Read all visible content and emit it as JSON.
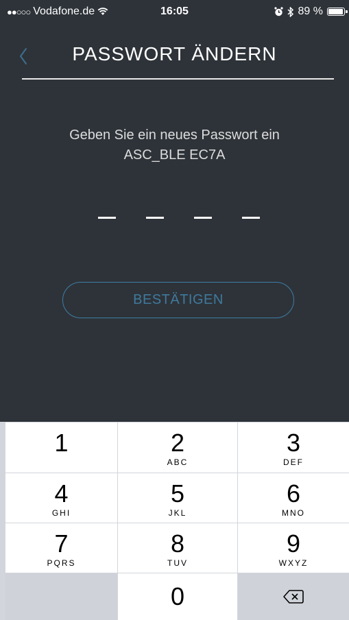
{
  "status": {
    "carrier": "Vodafone.de",
    "time": "16:05",
    "battery": "89 %",
    "battery_level": 0.89
  },
  "nav": {
    "title": "PASSWORT ÄNDERN"
  },
  "prompt": {
    "line1": "Geben Sie ein neues Passwort ein",
    "line2": "ASC_BLE EC7A"
  },
  "confirm_label": "BESTÄTIGEN",
  "keys": [
    {
      "num": "1",
      "letters": ""
    },
    {
      "num": "2",
      "letters": "ABC"
    },
    {
      "num": "3",
      "letters": "DEF"
    },
    {
      "num": "4",
      "letters": "GHI"
    },
    {
      "num": "5",
      "letters": "JKL"
    },
    {
      "num": "6",
      "letters": "MNO"
    },
    {
      "num": "7",
      "letters": "PQRS"
    },
    {
      "num": "8",
      "letters": "TUV"
    },
    {
      "num": "9",
      "letters": "WXYZ"
    },
    {
      "num": "0",
      "letters": ""
    }
  ],
  "colors": {
    "background": "#2e3339",
    "accent": "#3d7ea6",
    "keypad_bg": "#d2d5db"
  }
}
